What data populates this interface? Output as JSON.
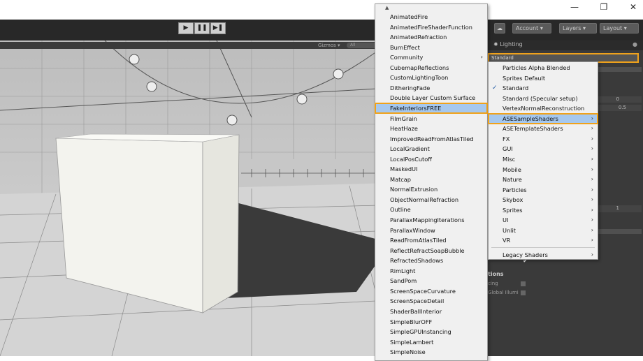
{
  "window": {
    "minimize_icon": "minimize-icon",
    "restore_icon": "restore-icon",
    "close_icon": "close-icon"
  },
  "toolbar": {
    "play_icon": "play-icon",
    "pause_icon": "pause-icon",
    "step_icon": "step-icon",
    "account": "Account",
    "layers": "Layers",
    "layout": "Layout",
    "cloud_icon": "cloud-icon"
  },
  "scene": {
    "gizmos": "Gizmos",
    "search_placeholder": "All"
  },
  "inspector": {
    "tab_lighting": "Lighting",
    "shader_field": "Standard",
    "value_0": "0",
    "value_05": "0.5",
    "value_1": "1",
    "text_tions": "tions",
    "text_cing": "cing",
    "text_global": "Global Illumi"
  },
  "left_menu": {
    "scroll_up_icon": "scroll-up-icon",
    "items": [
      "AnimatedFire",
      "AnimatedFireShaderFunction",
      "AnimatedRefraction",
      "BurnEffect",
      "Community",
      "CubemapReflections",
      "CustomLightingToon",
      "DitheringFade",
      "Double Layer Custom Surface",
      "FakeInteriorsFREE",
      "FilmGrain",
      "HeatHaze",
      "ImprovedReadFromAtlasTiled",
      "LocalGradient",
      "LocalPosCutoff",
      "MaskedUI",
      "Matcap",
      "NormalExtrusion",
      "ObjectNormalRefraction",
      "Outline",
      "ParallaxMappingIterations",
      "ParallaxWindow",
      "ReadFromAtlasTiled",
      "ReflectRefractSoapBubble",
      "RefractedShadows",
      "RimLight",
      "SandPom",
      "ScreenSpaceCurvature",
      "ScreenSpaceDetail",
      "ShaderBallInterior",
      "SimpleBlurOFF",
      "SimpleGPUInstancing",
      "SimpleLambert",
      "SimpleNoise"
    ],
    "submenu_index": 4,
    "selected_index": 9
  },
  "right_menu": {
    "items": [
      "Particles Alpha Blended",
      "Sprites Default",
      "Standard",
      "Standard (Specular setup)",
      "VertexNormalReconstruction",
      "ASESampleShaders",
      "ASETemplateShaders",
      "FX",
      "GUI",
      "Misc",
      "Mobile",
      "Nature",
      "Particles",
      "Skybox",
      "Sprites",
      "UI",
      "Unlit",
      "VR",
      "Legacy Shaders"
    ],
    "checked_index": 2,
    "selected_index": 5,
    "submenu_indices": [
      5,
      6,
      7,
      8,
      9,
      10,
      11,
      12,
      13,
      14,
      15,
      16,
      17,
      18
    ]
  },
  "colors": {
    "highlight_outline": "#f0a21b",
    "menu_selection": "#a6c8ee",
    "dark_ui": "#3a3a3a"
  }
}
